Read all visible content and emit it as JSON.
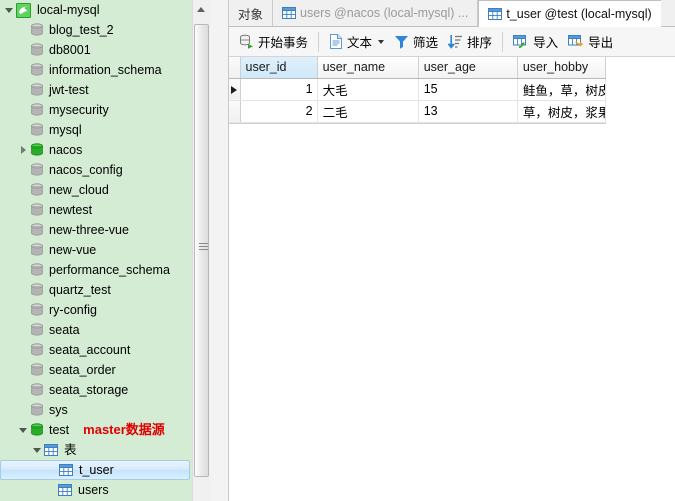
{
  "tree": {
    "root": {
      "label": "local-mysql",
      "icon": "mysql-dolphin-icon",
      "expanded": true
    },
    "items": [
      {
        "label": "blog_test_2",
        "icon": "database-icon",
        "state": "normal",
        "indent": 1,
        "arrow": "none"
      },
      {
        "label": "db8001",
        "icon": "database-icon",
        "state": "normal",
        "indent": 1,
        "arrow": "none"
      },
      {
        "label": "information_schema",
        "icon": "database-icon",
        "state": "normal",
        "indent": 1,
        "arrow": "none"
      },
      {
        "label": "jwt-test",
        "icon": "database-icon",
        "state": "normal",
        "indent": 1,
        "arrow": "none"
      },
      {
        "label": "mysecurity",
        "icon": "database-icon",
        "state": "normal",
        "indent": 1,
        "arrow": "none"
      },
      {
        "label": "mysql",
        "icon": "database-icon",
        "state": "normal",
        "indent": 1,
        "arrow": "none"
      },
      {
        "label": "nacos",
        "icon": "database-icon",
        "state": "connected",
        "indent": 1,
        "arrow": "closed"
      },
      {
        "label": "nacos_config",
        "icon": "database-icon",
        "state": "normal",
        "indent": 1,
        "arrow": "none"
      },
      {
        "label": "new_cloud",
        "icon": "database-icon",
        "state": "normal",
        "indent": 1,
        "arrow": "none"
      },
      {
        "label": "newtest",
        "icon": "database-icon",
        "state": "normal",
        "indent": 1,
        "arrow": "none"
      },
      {
        "label": "new-three-vue",
        "icon": "database-icon",
        "state": "normal",
        "indent": 1,
        "arrow": "none"
      },
      {
        "label": "new-vue",
        "icon": "database-icon",
        "state": "normal",
        "indent": 1,
        "arrow": "none"
      },
      {
        "label": "performance_schema",
        "icon": "database-icon",
        "state": "normal",
        "indent": 1,
        "arrow": "none"
      },
      {
        "label": "quartz_test",
        "icon": "database-icon",
        "state": "normal",
        "indent": 1,
        "arrow": "none"
      },
      {
        "label": "ry-config",
        "icon": "database-icon",
        "state": "normal",
        "indent": 1,
        "arrow": "none"
      },
      {
        "label": "seata",
        "icon": "database-icon",
        "state": "normal",
        "indent": 1,
        "arrow": "none"
      },
      {
        "label": "seata_account",
        "icon": "database-icon",
        "state": "normal",
        "indent": 1,
        "arrow": "none"
      },
      {
        "label": "seata_order",
        "icon": "database-icon",
        "state": "normal",
        "indent": 1,
        "arrow": "none"
      },
      {
        "label": "seata_storage",
        "icon": "database-icon",
        "state": "normal",
        "indent": 1,
        "arrow": "none"
      },
      {
        "label": "sys",
        "icon": "database-icon",
        "state": "normal",
        "indent": 1,
        "arrow": "none"
      },
      {
        "label": "test",
        "icon": "database-icon",
        "state": "connected",
        "indent": 1,
        "arrow": "open",
        "annotation": "master数据源"
      },
      {
        "label": "表",
        "icon": "table-folder-icon",
        "state": "normal",
        "indent": 2,
        "arrow": "open"
      },
      {
        "label": "t_user",
        "icon": "table-icon",
        "state": "normal",
        "indent": 3,
        "arrow": "none",
        "selected": true
      },
      {
        "label": "users",
        "icon": "table-icon",
        "state": "normal",
        "indent": 3,
        "arrow": "none"
      }
    ],
    "annotation_color": "#e00000"
  },
  "tabs": {
    "object_label": "对象",
    "items": [
      {
        "label": "users @nacos (local-mysql) ...",
        "active": false,
        "icon": "table-icon"
      },
      {
        "label": "t_user @test (local-mysql)",
        "active": true,
        "icon": "table-icon"
      }
    ]
  },
  "toolbar": {
    "buttons": [
      {
        "label": "开始事务",
        "icon": "begin-transaction-icon",
        "caret": false
      },
      {
        "label": "文本",
        "icon": "text-icon",
        "caret": true
      },
      {
        "label": "筛选",
        "icon": "filter-icon",
        "caret": false
      },
      {
        "label": "排序",
        "icon": "sort-icon",
        "caret": false
      },
      {
        "label": "导入",
        "icon": "import-icon",
        "caret": false
      },
      {
        "label": "导出",
        "icon": "export-icon",
        "caret": false
      }
    ]
  },
  "grid": {
    "columns": [
      "user_id",
      "user_name",
      "user_age",
      "user_hobby"
    ],
    "selected_column": "user_id",
    "rows": [
      {
        "current": true,
        "cells": [
          "1",
          "大毛",
          "15",
          "鲑鱼，草，树皮"
        ]
      },
      {
        "current": false,
        "cells": [
          "2",
          "二毛",
          "13",
          "草，树皮，浆果"
        ]
      }
    ]
  },
  "colors": {
    "tree_background": "#d4ecd4",
    "accent": "#3b7fc4",
    "annotation_red": "#e00000",
    "db_connected_green": "#2fb82f"
  }
}
